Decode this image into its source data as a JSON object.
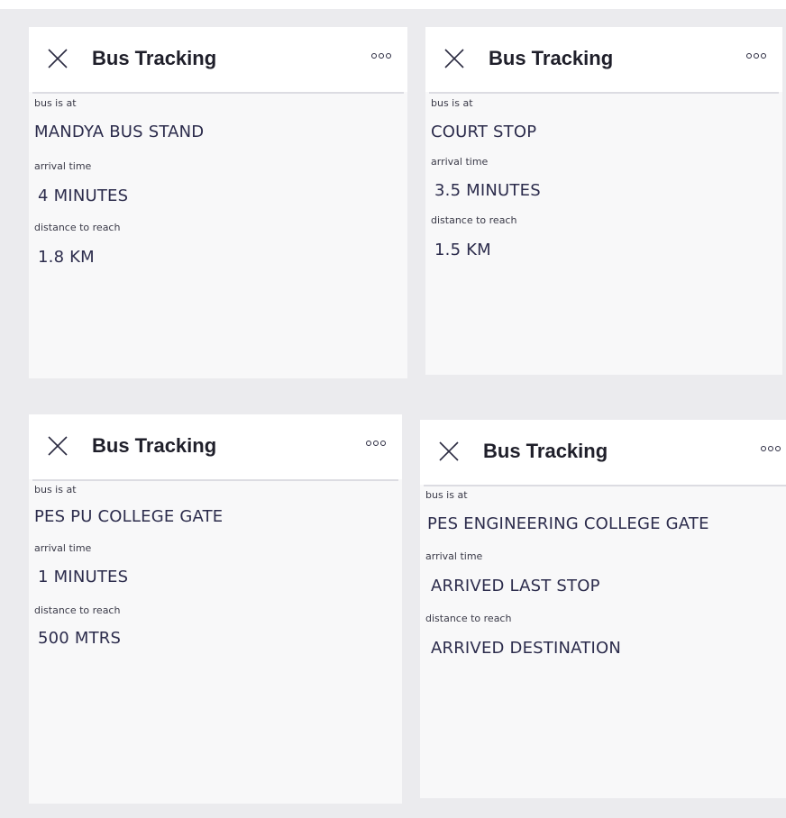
{
  "cards": [
    {
      "title": "Bus Tracking",
      "bus_label": "bus is at",
      "location": "MANDYA BUS STAND",
      "arrival_label": "arrival time",
      "arrival_value": "4 MINUTES",
      "distance_label": "distance to reach",
      "distance_value": "1.8 KM"
    },
    {
      "title": "Bus Tracking",
      "bus_label": "bus is at",
      "location": "COURT STOP",
      "arrival_label": "arrival time",
      "arrival_value": "3.5 MINUTES",
      "distance_label": "distance to reach",
      "distance_value": "1.5 KM"
    },
    {
      "title": "Bus Tracking",
      "bus_label": "bus is at",
      "location": "PES PU COLLEGE GATE",
      "arrival_label": "arrival time",
      "arrival_value": "1 MINUTES",
      "distance_label": "distance to reach",
      "distance_value": "500 MTRS"
    },
    {
      "title": "Bus Tracking",
      "bus_label": "bus is at",
      "location": "PES ENGINEERING COLLEGE GATE",
      "arrival_label": "arrival time",
      "arrival_value": "ARRIVED LAST STOP",
      "distance_label": "distance to reach",
      "distance_value": "ARRIVED DESTINATION"
    }
  ],
  "icons": {
    "close": "close-icon",
    "more": "more-options-icon"
  }
}
